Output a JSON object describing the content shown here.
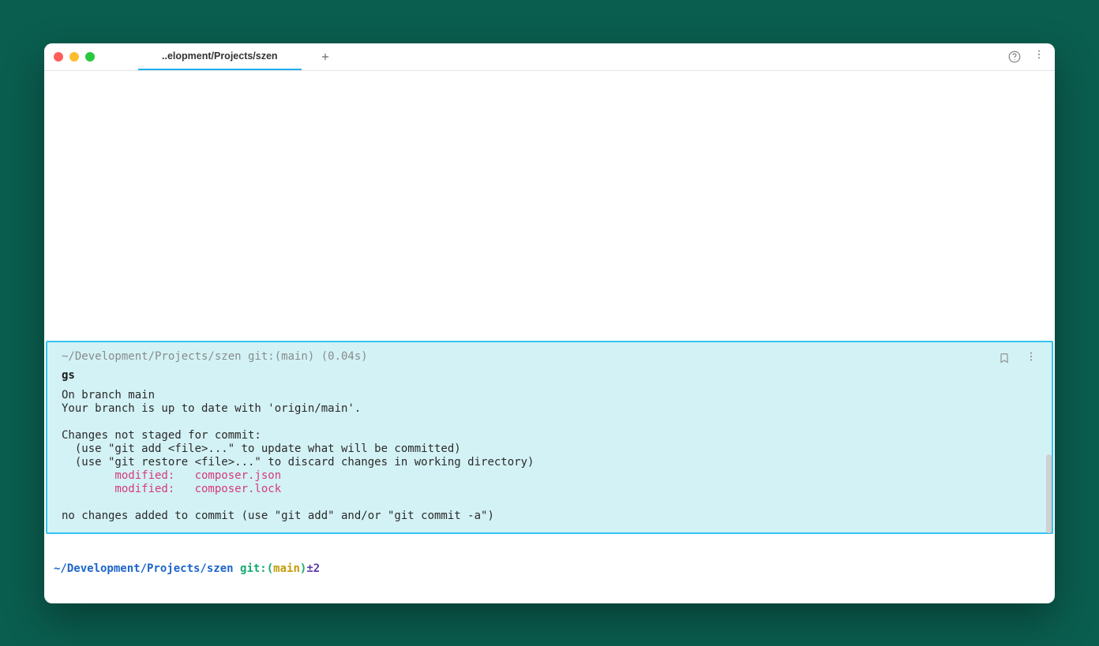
{
  "tab": {
    "title": "..elopment/Projects/szen"
  },
  "block": {
    "header": "~/Development/Projects/szen git:(main) (0.04s)",
    "command": "gs",
    "out1": "On branch main",
    "out2": "Your branch is up to date with 'origin/main'.",
    "out3": "Changes not staged for commit:",
    "out4": "  (use \"git add <file>...\" to update what will be committed)",
    "out5": "  (use \"git restore <file>...\" to discard changes in working directory)",
    "mod1": "        modified:   composer.json",
    "mod2": "        modified:   composer.lock",
    "out6": "no changes added to commit (use \"git add\" and/or \"git commit -a\")"
  },
  "prompt": {
    "path": "~/Development/Projects/szen",
    "git_label": "git:",
    "paren_open": "(",
    "branch": "main",
    "paren_close": ")",
    "dirty": "±2"
  }
}
